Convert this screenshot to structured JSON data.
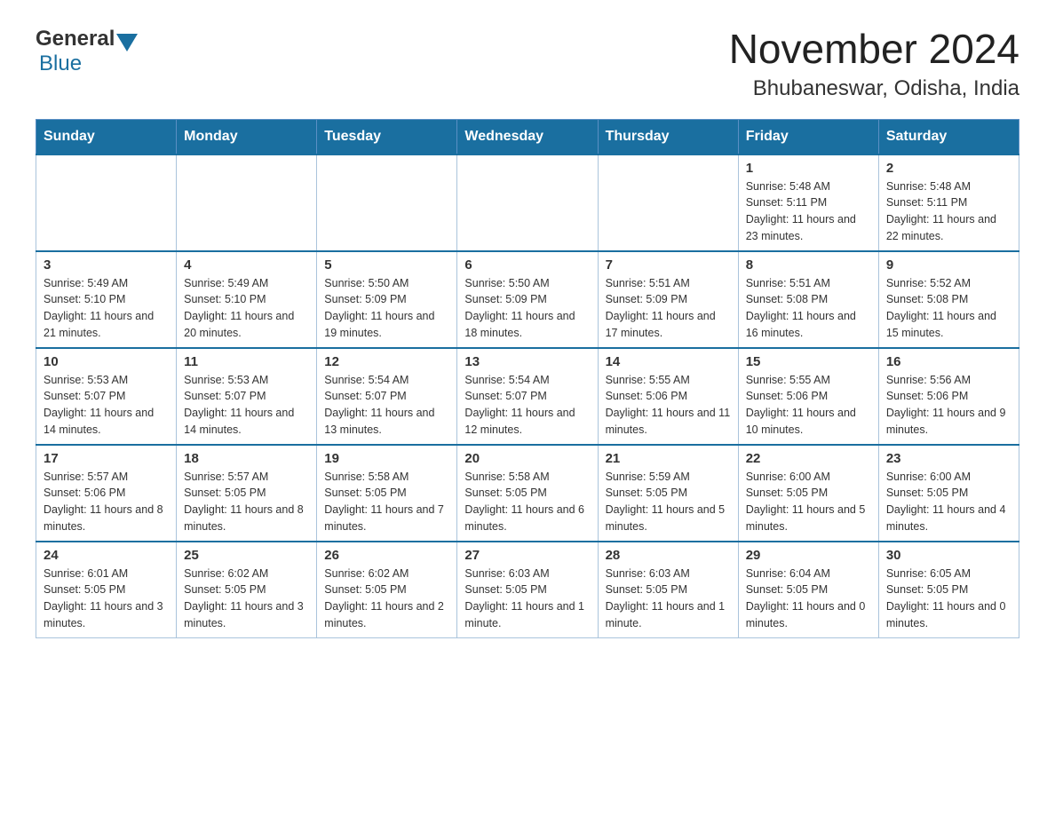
{
  "logo": {
    "general": "General",
    "blue": "Blue"
  },
  "title": "November 2024",
  "subtitle": "Bhubaneswar, Odisha, India",
  "weekdays": [
    "Sunday",
    "Monday",
    "Tuesday",
    "Wednesday",
    "Thursday",
    "Friday",
    "Saturday"
  ],
  "weeks": [
    [
      {
        "day": "",
        "info": ""
      },
      {
        "day": "",
        "info": ""
      },
      {
        "day": "",
        "info": ""
      },
      {
        "day": "",
        "info": ""
      },
      {
        "day": "",
        "info": ""
      },
      {
        "day": "1",
        "info": "Sunrise: 5:48 AM\nSunset: 5:11 PM\nDaylight: 11 hours and 23 minutes."
      },
      {
        "day": "2",
        "info": "Sunrise: 5:48 AM\nSunset: 5:11 PM\nDaylight: 11 hours and 22 minutes."
      }
    ],
    [
      {
        "day": "3",
        "info": "Sunrise: 5:49 AM\nSunset: 5:10 PM\nDaylight: 11 hours and 21 minutes."
      },
      {
        "day": "4",
        "info": "Sunrise: 5:49 AM\nSunset: 5:10 PM\nDaylight: 11 hours and 20 minutes."
      },
      {
        "day": "5",
        "info": "Sunrise: 5:50 AM\nSunset: 5:09 PM\nDaylight: 11 hours and 19 minutes."
      },
      {
        "day": "6",
        "info": "Sunrise: 5:50 AM\nSunset: 5:09 PM\nDaylight: 11 hours and 18 minutes."
      },
      {
        "day": "7",
        "info": "Sunrise: 5:51 AM\nSunset: 5:09 PM\nDaylight: 11 hours and 17 minutes."
      },
      {
        "day": "8",
        "info": "Sunrise: 5:51 AM\nSunset: 5:08 PM\nDaylight: 11 hours and 16 minutes."
      },
      {
        "day": "9",
        "info": "Sunrise: 5:52 AM\nSunset: 5:08 PM\nDaylight: 11 hours and 15 minutes."
      }
    ],
    [
      {
        "day": "10",
        "info": "Sunrise: 5:53 AM\nSunset: 5:07 PM\nDaylight: 11 hours and 14 minutes."
      },
      {
        "day": "11",
        "info": "Sunrise: 5:53 AM\nSunset: 5:07 PM\nDaylight: 11 hours and 14 minutes."
      },
      {
        "day": "12",
        "info": "Sunrise: 5:54 AM\nSunset: 5:07 PM\nDaylight: 11 hours and 13 minutes."
      },
      {
        "day": "13",
        "info": "Sunrise: 5:54 AM\nSunset: 5:07 PM\nDaylight: 11 hours and 12 minutes."
      },
      {
        "day": "14",
        "info": "Sunrise: 5:55 AM\nSunset: 5:06 PM\nDaylight: 11 hours and 11 minutes."
      },
      {
        "day": "15",
        "info": "Sunrise: 5:55 AM\nSunset: 5:06 PM\nDaylight: 11 hours and 10 minutes."
      },
      {
        "day": "16",
        "info": "Sunrise: 5:56 AM\nSunset: 5:06 PM\nDaylight: 11 hours and 9 minutes."
      }
    ],
    [
      {
        "day": "17",
        "info": "Sunrise: 5:57 AM\nSunset: 5:06 PM\nDaylight: 11 hours and 8 minutes."
      },
      {
        "day": "18",
        "info": "Sunrise: 5:57 AM\nSunset: 5:05 PM\nDaylight: 11 hours and 8 minutes."
      },
      {
        "day": "19",
        "info": "Sunrise: 5:58 AM\nSunset: 5:05 PM\nDaylight: 11 hours and 7 minutes."
      },
      {
        "day": "20",
        "info": "Sunrise: 5:58 AM\nSunset: 5:05 PM\nDaylight: 11 hours and 6 minutes."
      },
      {
        "day": "21",
        "info": "Sunrise: 5:59 AM\nSunset: 5:05 PM\nDaylight: 11 hours and 5 minutes."
      },
      {
        "day": "22",
        "info": "Sunrise: 6:00 AM\nSunset: 5:05 PM\nDaylight: 11 hours and 5 minutes."
      },
      {
        "day": "23",
        "info": "Sunrise: 6:00 AM\nSunset: 5:05 PM\nDaylight: 11 hours and 4 minutes."
      }
    ],
    [
      {
        "day": "24",
        "info": "Sunrise: 6:01 AM\nSunset: 5:05 PM\nDaylight: 11 hours and 3 minutes."
      },
      {
        "day": "25",
        "info": "Sunrise: 6:02 AM\nSunset: 5:05 PM\nDaylight: 11 hours and 3 minutes."
      },
      {
        "day": "26",
        "info": "Sunrise: 6:02 AM\nSunset: 5:05 PM\nDaylight: 11 hours and 2 minutes."
      },
      {
        "day": "27",
        "info": "Sunrise: 6:03 AM\nSunset: 5:05 PM\nDaylight: 11 hours and 1 minute."
      },
      {
        "day": "28",
        "info": "Sunrise: 6:03 AM\nSunset: 5:05 PM\nDaylight: 11 hours and 1 minute."
      },
      {
        "day": "29",
        "info": "Sunrise: 6:04 AM\nSunset: 5:05 PM\nDaylight: 11 hours and 0 minutes."
      },
      {
        "day": "30",
        "info": "Sunrise: 6:05 AM\nSunset: 5:05 PM\nDaylight: 11 hours and 0 minutes."
      }
    ]
  ]
}
